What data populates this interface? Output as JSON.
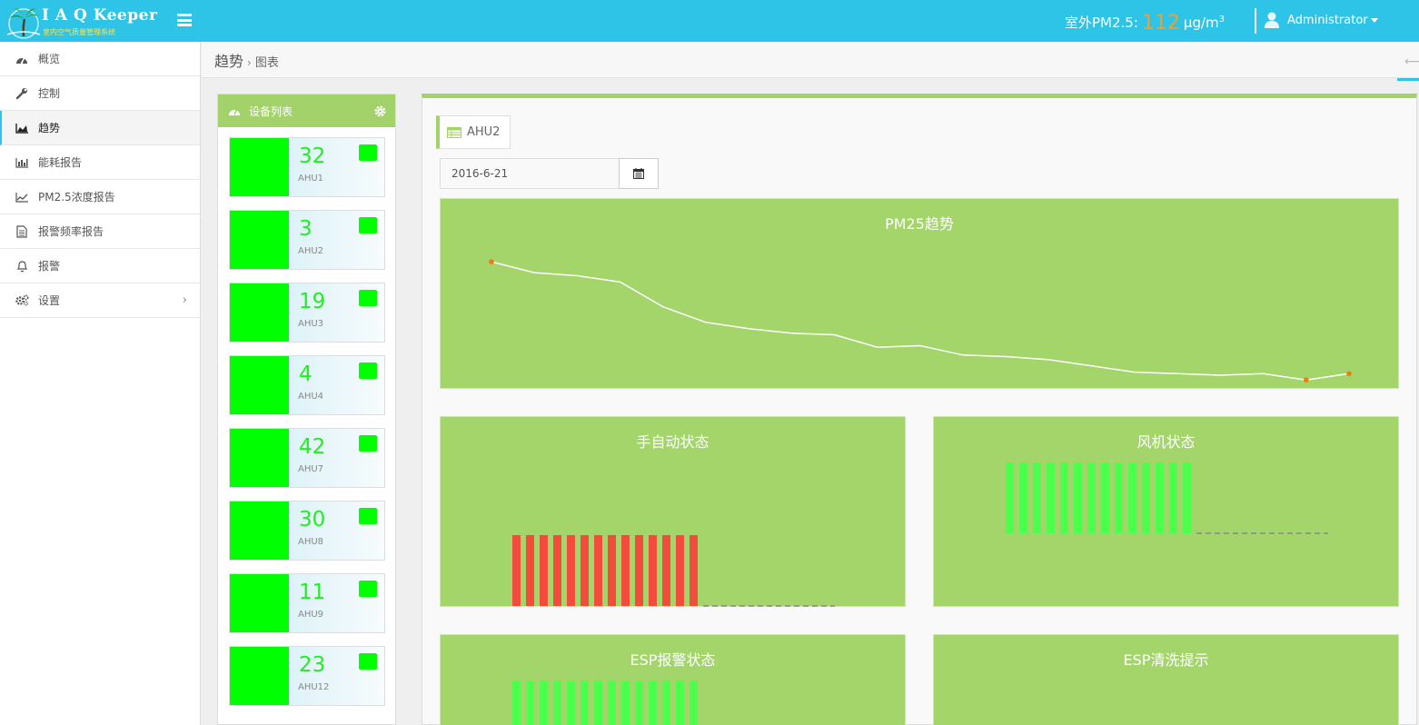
{
  "header": {
    "app_title": "I A Q Keeper",
    "app_subtitle": "室内空气质量管理系统",
    "pm_label": "室外PM2.5:",
    "pm_value": "112",
    "pm_unit": "μg/m",
    "pm_unit_sup": "3",
    "user_name": "Administrator"
  },
  "sidebar": {
    "items": [
      {
        "label": "概览",
        "icon": "dashboard-icon"
      },
      {
        "label": "控制",
        "icon": "wrench-icon"
      },
      {
        "label": "趋势",
        "icon": "area-chart-icon"
      },
      {
        "label": "能耗报告",
        "icon": "bar-chart-icon"
      },
      {
        "label": "PM2.5浓度报告",
        "icon": "line-chart-icon"
      },
      {
        "label": "报警频率报告",
        "icon": "document-icon"
      },
      {
        "label": "报警",
        "icon": "bell-icon"
      },
      {
        "label": "设置",
        "icon": "gears-icon"
      }
    ],
    "active_index": 2
  },
  "breadcrumb": {
    "main": "趋势",
    "separator": "›",
    "sub": "图表"
  },
  "device_panel": {
    "title": "设备列表",
    "devices": [
      {
        "value": "32",
        "name": "AHU1"
      },
      {
        "value": "3",
        "name": "AHU2"
      },
      {
        "value": "19",
        "name": "AHU3"
      },
      {
        "value": "4",
        "name": "AHU4"
      },
      {
        "value": "42",
        "name": "AHU7"
      },
      {
        "value": "30",
        "name": "AHU8"
      },
      {
        "value": "11",
        "name": "AHU9"
      },
      {
        "value": "23",
        "name": "AHU12"
      }
    ]
  },
  "main": {
    "selected_device": "AHU2",
    "date_value": "2016-6-21"
  },
  "colors": {
    "topbar": "#2ec4e8",
    "panel_green": "#a3d26a",
    "device_swatch": "#00ff00",
    "pm_value": "#f0a030",
    "bar_red": "#f44c3c",
    "bar_green": "#4cff4c",
    "line": "#ffffff",
    "marker": "#f07c10"
  },
  "chart_data": [
    {
      "type": "line",
      "title": "PM25趋势",
      "x": [
        1,
        2,
        3,
        4,
        5,
        6,
        7,
        8,
        9,
        10,
        11,
        12,
        13,
        14,
        15,
        16,
        17,
        18,
        19,
        20,
        21
      ],
      "values": [
        100,
        93,
        91,
        87,
        71,
        61,
        57,
        54,
        53,
        45,
        46,
        40,
        39,
        37,
        33,
        29,
        28,
        27,
        28,
        24,
        28
      ],
      "ylim": [
        20,
        110
      ],
      "markers": [
        1,
        20,
        21
      ]
    },
    {
      "type": "bar",
      "title": "手自动状态",
      "values": [
        1,
        1,
        1,
        1,
        1,
        1,
        1,
        1,
        1,
        1,
        1,
        1,
        1,
        1,
        0,
        0,
        0,
        0,
        0,
        0,
        0,
        0,
        0,
        0
      ],
      "ylim": [
        0,
        2
      ],
      "color": "#f44c3c"
    },
    {
      "type": "bar",
      "title": "风机状态",
      "values": [
        1,
        1,
        1,
        1,
        1,
        1,
        1,
        1,
        1,
        1,
        1,
        1,
        1,
        1,
        0,
        0,
        0,
        0,
        0,
        0,
        0,
        0,
        0,
        0
      ],
      "ylim": [
        0,
        1
      ],
      "color": "#4cff4c"
    },
    {
      "type": "bar",
      "title": "ESP报警状态",
      "values": [
        1,
        1,
        1,
        1,
        1,
        1,
        1,
        1,
        1,
        1,
        1,
        1,
        1,
        1
      ],
      "ylim": [
        0,
        1
      ],
      "color": "#4cff4c"
    },
    {
      "type": "bar",
      "title": "ESP清洗提示",
      "values": [],
      "ylim": [
        0,
        1
      ],
      "color": "#4cff4c"
    }
  ]
}
